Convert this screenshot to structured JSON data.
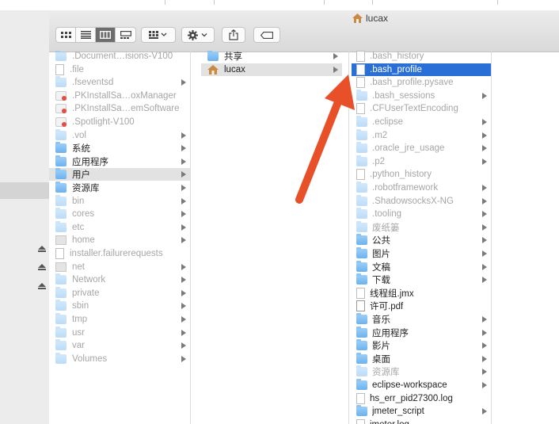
{
  "window": {
    "title": "lucax",
    "title_icon": "home-icon"
  },
  "toolbar": {
    "view_icons": [
      "icon-view-icon",
      "list-view-icon",
      "column-view-icon",
      "gallery-view-icon"
    ],
    "active_view": 2,
    "arrange_icon": "arrange-grid-icon",
    "action_icon": "gear-icon",
    "share_icon": "share-icon",
    "tag_icon": "tag-icon"
  },
  "column1": {
    "items": [
      {
        "label": ".Document…isions-V100",
        "icon": "folder-icon",
        "dim": true,
        "arrow": false
      },
      {
        "label": ".file",
        "icon": "document-icon",
        "dim": true,
        "arrow": false
      },
      {
        "label": ".fseventsd",
        "icon": "folder-icon",
        "dim": true,
        "arrow": true
      },
      {
        "label": ".PKInstallSa…oxManager",
        "icon": "package-icon",
        "dim": true,
        "arrow": false
      },
      {
        "label": ".PKInstallSa…emSoftware",
        "icon": "package-icon",
        "dim": true,
        "arrow": false
      },
      {
        "label": ".Spotlight-V100",
        "icon": "package-icon",
        "dim": true,
        "arrow": false
      },
      {
        "label": ".vol",
        "icon": "folder-icon",
        "dim": true,
        "arrow": true
      },
      {
        "label": "系统",
        "icon": "folder-icon",
        "dim": false,
        "arrow": true
      },
      {
        "label": "应用程序",
        "icon": "folder-icon",
        "dim": false,
        "arrow": true
      },
      {
        "label": "用户",
        "icon": "folder-icon",
        "dim": false,
        "arrow": true
      },
      {
        "label": "资源库",
        "icon": "folder-icon",
        "dim": false,
        "arrow": true
      },
      {
        "label": "bin",
        "icon": "folder-icon",
        "dim": true,
        "arrow": true
      },
      {
        "label": "cores",
        "icon": "folder-icon",
        "dim": true,
        "arrow": true
      },
      {
        "label": "etc",
        "icon": "alias-folder-icon",
        "dim": true,
        "arrow": true
      },
      {
        "label": "home",
        "icon": "drive-icon",
        "dim": true,
        "arrow": true
      },
      {
        "label": "installer.failurerequests",
        "icon": "document-icon",
        "dim": true,
        "arrow": false
      },
      {
        "label": "net",
        "icon": "drive-icon",
        "dim": true,
        "arrow": true
      },
      {
        "label": "Network",
        "icon": "folder-icon",
        "dim": true,
        "arrow": true
      },
      {
        "label": "private",
        "icon": "folder-icon",
        "dim": true,
        "arrow": true
      },
      {
        "label": "sbin",
        "icon": "folder-icon",
        "dim": true,
        "arrow": true
      },
      {
        "label": "tmp",
        "icon": "alias-folder-icon",
        "dim": true,
        "arrow": true
      },
      {
        "label": "usr",
        "icon": "folder-icon",
        "dim": true,
        "arrow": true
      },
      {
        "label": "var",
        "icon": "alias-folder-icon",
        "dim": true,
        "arrow": true
      },
      {
        "label": "Volumes",
        "icon": "folder-icon",
        "dim": true,
        "arrow": true
      }
    ],
    "highlighted_index": 9
  },
  "column2": {
    "items": [
      {
        "label": "共享",
        "icon": "folder-icon",
        "dim": false,
        "arrow": true
      },
      {
        "label": "lucax",
        "icon": "home-icon",
        "dim": false,
        "arrow": true
      }
    ],
    "highlighted_index": 1
  },
  "column3": {
    "items": [
      {
        "label": ".bash_history",
        "icon": "document-icon",
        "dim": true,
        "arrow": false
      },
      {
        "label": ".bash_profile",
        "icon": "document-icon",
        "dim": false,
        "arrow": false
      },
      {
        "label": ".bash_profile.pysave",
        "icon": "document-icon",
        "dim": true,
        "arrow": false
      },
      {
        "label": ".bash_sessions",
        "icon": "folder-icon",
        "dim": true,
        "arrow": true
      },
      {
        "label": ".CFUserTextEncoding",
        "icon": "document-icon",
        "dim": true,
        "arrow": false
      },
      {
        "label": ".eclipse",
        "icon": "folder-icon",
        "dim": true,
        "arrow": true
      },
      {
        "label": ".m2",
        "icon": "folder-icon",
        "dim": true,
        "arrow": true
      },
      {
        "label": ".oracle_jre_usage",
        "icon": "folder-icon",
        "dim": true,
        "arrow": true
      },
      {
        "label": ".p2",
        "icon": "folder-icon",
        "dim": true,
        "arrow": true
      },
      {
        "label": ".python_history",
        "icon": "document-icon",
        "dim": true,
        "arrow": false
      },
      {
        "label": ".robotframework",
        "icon": "folder-icon",
        "dim": true,
        "arrow": true
      },
      {
        "label": ".ShadowsocksX-NG",
        "icon": "folder-icon",
        "dim": true,
        "arrow": true
      },
      {
        "label": ".tooling",
        "icon": "folder-icon",
        "dim": true,
        "arrow": true
      },
      {
        "label": "废纸篓",
        "icon": "folder-icon",
        "dim": true,
        "arrow": true
      },
      {
        "label": "公共",
        "icon": "folder-icon",
        "dim": false,
        "arrow": true
      },
      {
        "label": "图片",
        "icon": "folder-icon",
        "dim": false,
        "arrow": true
      },
      {
        "label": "文稿",
        "icon": "folder-icon",
        "dim": false,
        "arrow": true
      },
      {
        "label": "下载",
        "icon": "folder-icon",
        "dim": false,
        "arrow": true
      },
      {
        "label": "线程组.jmx",
        "icon": "document-icon",
        "dim": false,
        "arrow": false
      },
      {
        "label": "许可.pdf",
        "icon": "pdf-icon",
        "dim": false,
        "arrow": false
      },
      {
        "label": "音乐",
        "icon": "folder-icon",
        "dim": false,
        "arrow": true
      },
      {
        "label": "应用程序",
        "icon": "folder-icon",
        "dim": false,
        "arrow": true
      },
      {
        "label": "影片",
        "icon": "folder-icon",
        "dim": false,
        "arrow": true
      },
      {
        "label": "桌面",
        "icon": "folder-icon",
        "dim": false,
        "arrow": true
      },
      {
        "label": "资源库",
        "icon": "folder-icon",
        "dim": true,
        "arrow": true
      },
      {
        "label": "eclipse-workspace",
        "icon": "folder-icon",
        "dim": false,
        "arrow": true
      },
      {
        "label": "hs_err_pid27300.log",
        "icon": "document-icon",
        "dim": false,
        "arrow": false
      },
      {
        "label": "jmeter_script",
        "icon": "folder-icon",
        "dim": false,
        "arrow": true
      },
      {
        "label": "jmeter.log",
        "icon": "document-icon",
        "dim": false,
        "arrow": false
      }
    ],
    "selected_index": 1
  },
  "sidebar": {
    "eject_icons": [
      "eject-icon",
      "eject-icon",
      "eject-icon"
    ]
  },
  "annotation": {
    "icon": "red-arrow-annotation",
    "color": "#e8502a"
  },
  "colors": {
    "selection": "#2a6fd6",
    "folder": "#7cbcf2",
    "arrow": "#e8502a"
  }
}
